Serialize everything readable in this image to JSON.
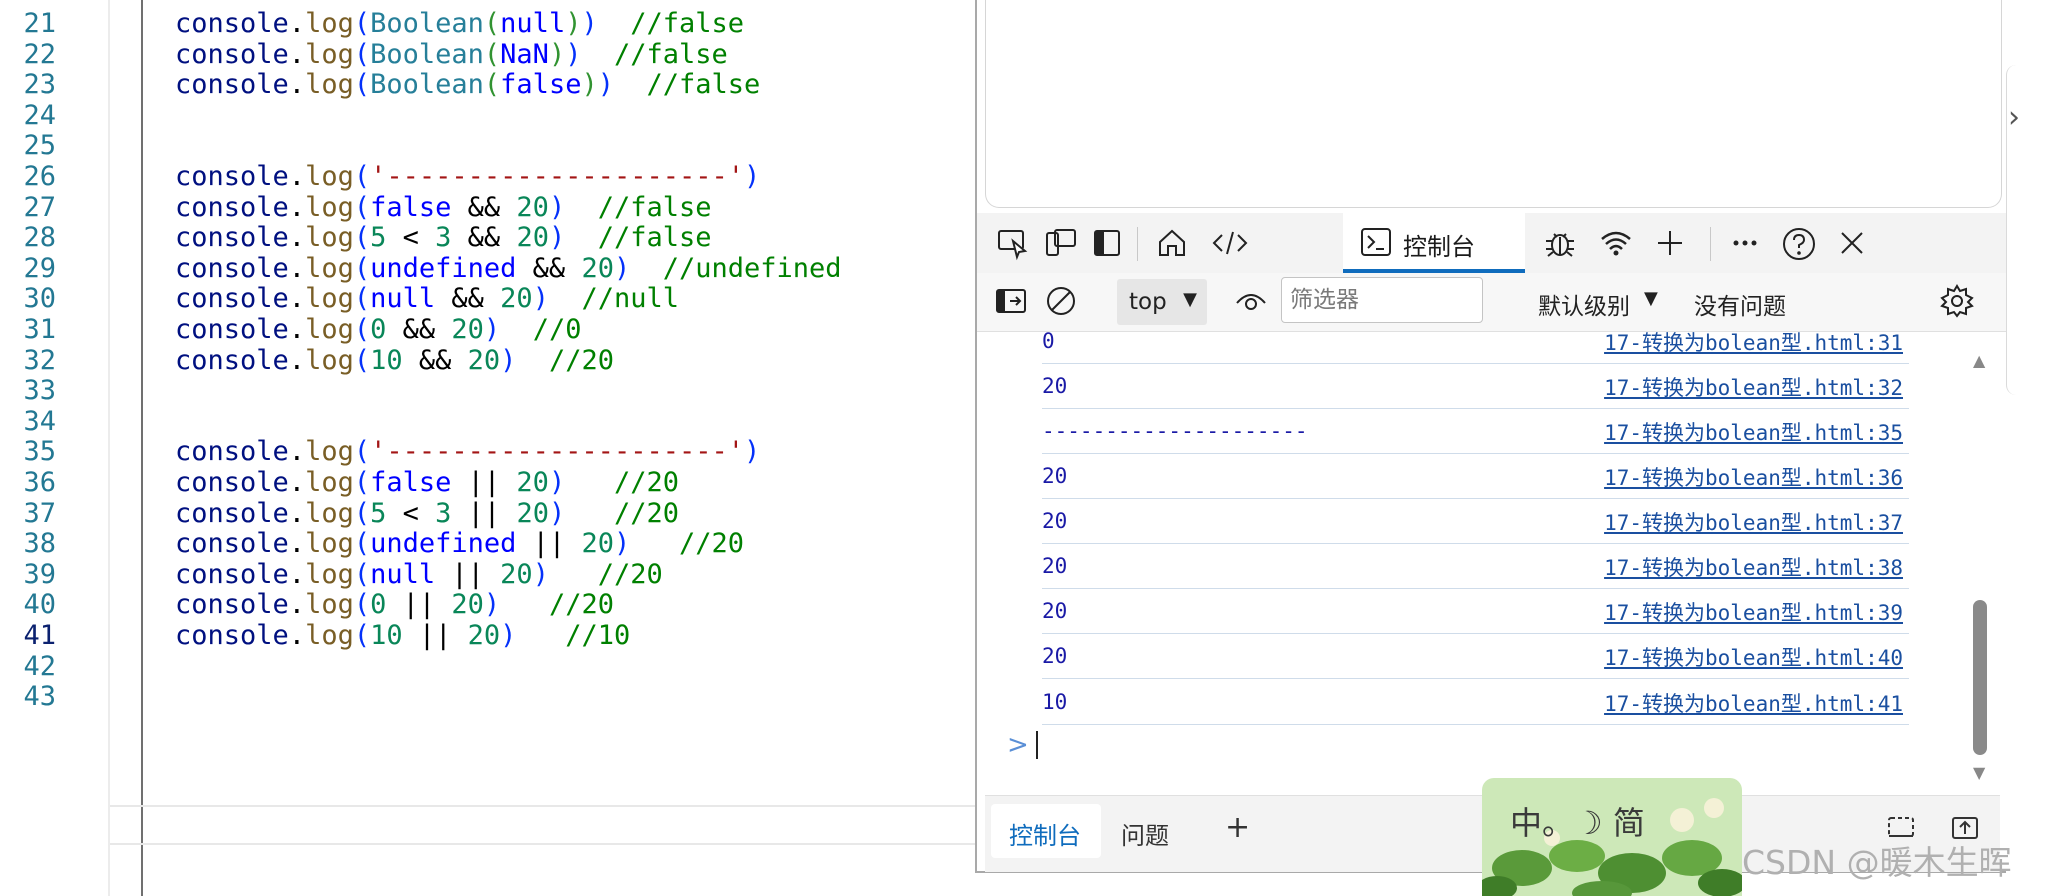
{
  "editor": {
    "lines": [
      {
        "num": "21",
        "tokens": [
          [
            "c-obj",
            "console"
          ],
          [
            "c-op",
            "."
          ],
          [
            "c-fn",
            "log"
          ],
          [
            "c-p1",
            "("
          ],
          [
            "c-type",
            "Boolean"
          ],
          [
            "c-p2",
            "("
          ],
          [
            "c-kw",
            "null"
          ],
          [
            "c-p2",
            ")"
          ],
          [
            "c-p1",
            ")"
          ],
          [
            "c-op",
            "  "
          ],
          [
            "c-cm",
            "//false"
          ]
        ]
      },
      {
        "num": "22",
        "tokens": [
          [
            "c-obj",
            "console"
          ],
          [
            "c-op",
            "."
          ],
          [
            "c-fn",
            "log"
          ],
          [
            "c-p1",
            "("
          ],
          [
            "c-type",
            "Boolean"
          ],
          [
            "c-p2",
            "("
          ],
          [
            "c-kw",
            "NaN"
          ],
          [
            "c-p2",
            ")"
          ],
          [
            "c-p1",
            ")"
          ],
          [
            "c-op",
            "  "
          ],
          [
            "c-cm",
            "//false"
          ]
        ]
      },
      {
        "num": "23",
        "tokens": [
          [
            "c-obj",
            "console"
          ],
          [
            "c-op",
            "."
          ],
          [
            "c-fn",
            "log"
          ],
          [
            "c-p1",
            "("
          ],
          [
            "c-type",
            "Boolean"
          ],
          [
            "c-p2",
            "("
          ],
          [
            "c-kw",
            "false"
          ],
          [
            "c-p2",
            ")"
          ],
          [
            "c-p1",
            ")"
          ],
          [
            "c-op",
            "  "
          ],
          [
            "c-cm",
            "//false"
          ]
        ]
      },
      {
        "num": "24",
        "tokens": []
      },
      {
        "num": "25",
        "tokens": []
      },
      {
        "num": "26",
        "tokens": [
          [
            "c-obj",
            "console"
          ],
          [
            "c-op",
            "."
          ],
          [
            "c-fn",
            "log"
          ],
          [
            "c-p1",
            "("
          ],
          [
            "c-str",
            "'---------------------'"
          ],
          [
            "c-p1",
            ")"
          ]
        ]
      },
      {
        "num": "27",
        "tokens": [
          [
            "c-obj",
            "console"
          ],
          [
            "c-op",
            "."
          ],
          [
            "c-fn",
            "log"
          ],
          [
            "c-p1",
            "("
          ],
          [
            "c-kw",
            "false"
          ],
          [
            "c-op",
            " && "
          ],
          [
            "c-num",
            "20"
          ],
          [
            "c-p1",
            ")"
          ],
          [
            "c-op",
            "  "
          ],
          [
            "c-cm",
            "//false"
          ]
        ]
      },
      {
        "num": "28",
        "tokens": [
          [
            "c-obj",
            "console"
          ],
          [
            "c-op",
            "."
          ],
          [
            "c-fn",
            "log"
          ],
          [
            "c-p1",
            "("
          ],
          [
            "c-num",
            "5"
          ],
          [
            "c-op",
            " < "
          ],
          [
            "c-num",
            "3"
          ],
          [
            "c-op",
            " && "
          ],
          [
            "c-num",
            "20"
          ],
          [
            "c-p1",
            ")"
          ],
          [
            "c-op",
            "  "
          ],
          [
            "c-cm",
            "//false"
          ]
        ]
      },
      {
        "num": "29",
        "tokens": [
          [
            "c-obj",
            "console"
          ],
          [
            "c-op",
            "."
          ],
          [
            "c-fn",
            "log"
          ],
          [
            "c-p1",
            "("
          ],
          [
            "c-kw",
            "undefined"
          ],
          [
            "c-op",
            " && "
          ],
          [
            "c-num",
            "20"
          ],
          [
            "c-p1",
            ")"
          ],
          [
            "c-op",
            "  "
          ],
          [
            "c-cm",
            "//undefined"
          ]
        ]
      },
      {
        "num": "30",
        "tokens": [
          [
            "c-obj",
            "console"
          ],
          [
            "c-op",
            "."
          ],
          [
            "c-fn",
            "log"
          ],
          [
            "c-p1",
            "("
          ],
          [
            "c-kw",
            "null"
          ],
          [
            "c-op",
            " && "
          ],
          [
            "c-num",
            "20"
          ],
          [
            "c-p1",
            ")"
          ],
          [
            "c-op",
            "  "
          ],
          [
            "c-cm",
            "//null"
          ]
        ]
      },
      {
        "num": "31",
        "tokens": [
          [
            "c-obj",
            "console"
          ],
          [
            "c-op",
            "."
          ],
          [
            "c-fn",
            "log"
          ],
          [
            "c-p1",
            "("
          ],
          [
            "c-num",
            "0"
          ],
          [
            "c-op",
            " && "
          ],
          [
            "c-num",
            "20"
          ],
          [
            "c-p1",
            ")"
          ],
          [
            "c-op",
            "  "
          ],
          [
            "c-cm",
            "//0"
          ]
        ]
      },
      {
        "num": "32",
        "tokens": [
          [
            "c-obj",
            "console"
          ],
          [
            "c-op",
            "."
          ],
          [
            "c-fn",
            "log"
          ],
          [
            "c-p1",
            "("
          ],
          [
            "c-num",
            "10"
          ],
          [
            "c-op",
            " && "
          ],
          [
            "c-num",
            "20"
          ],
          [
            "c-p1",
            ")"
          ],
          [
            "c-op",
            "  "
          ],
          [
            "c-cm",
            "//20"
          ]
        ]
      },
      {
        "num": "33",
        "tokens": []
      },
      {
        "num": "34",
        "tokens": []
      },
      {
        "num": "35",
        "tokens": [
          [
            "c-obj",
            "console"
          ],
          [
            "c-op",
            "."
          ],
          [
            "c-fn",
            "log"
          ],
          [
            "c-p1",
            "("
          ],
          [
            "c-str",
            "'---------------------'"
          ],
          [
            "c-p1",
            ")"
          ]
        ]
      },
      {
        "num": "36",
        "tokens": [
          [
            "c-obj",
            "console"
          ],
          [
            "c-op",
            "."
          ],
          [
            "c-fn",
            "log"
          ],
          [
            "c-p1",
            "("
          ],
          [
            "c-kw",
            "false"
          ],
          [
            "c-op",
            " || "
          ],
          [
            "c-num",
            "20"
          ],
          [
            "c-p1",
            ")"
          ],
          [
            "c-op",
            "   "
          ],
          [
            "c-cm",
            "//20"
          ]
        ]
      },
      {
        "num": "37",
        "tokens": [
          [
            "c-obj",
            "console"
          ],
          [
            "c-op",
            "."
          ],
          [
            "c-fn",
            "log"
          ],
          [
            "c-p1",
            "("
          ],
          [
            "c-num",
            "5"
          ],
          [
            "c-op",
            " < "
          ],
          [
            "c-num",
            "3"
          ],
          [
            "c-op",
            " || "
          ],
          [
            "c-num",
            "20"
          ],
          [
            "c-p1",
            ")"
          ],
          [
            "c-op",
            "   "
          ],
          [
            "c-cm",
            "//20"
          ]
        ]
      },
      {
        "num": "38",
        "tokens": [
          [
            "c-obj",
            "console"
          ],
          [
            "c-op",
            "."
          ],
          [
            "c-fn",
            "log"
          ],
          [
            "c-p1",
            "("
          ],
          [
            "c-kw",
            "undefined"
          ],
          [
            "c-op",
            " || "
          ],
          [
            "c-num",
            "20"
          ],
          [
            "c-p1",
            ")"
          ],
          [
            "c-op",
            "   "
          ],
          [
            "c-cm",
            "//20"
          ]
        ]
      },
      {
        "num": "39",
        "tokens": [
          [
            "c-obj",
            "console"
          ],
          [
            "c-op",
            "."
          ],
          [
            "c-fn",
            "log"
          ],
          [
            "c-p1",
            "("
          ],
          [
            "c-kw",
            "null"
          ],
          [
            "c-op",
            " || "
          ],
          [
            "c-num",
            "20"
          ],
          [
            "c-p1",
            ")"
          ],
          [
            "c-op",
            "   "
          ],
          [
            "c-cm",
            "//20"
          ]
        ]
      },
      {
        "num": "40",
        "tokens": [
          [
            "c-obj",
            "console"
          ],
          [
            "c-op",
            "."
          ],
          [
            "c-fn",
            "log"
          ],
          [
            "c-p1",
            "("
          ],
          [
            "c-num",
            "0"
          ],
          [
            "c-op",
            " || "
          ],
          [
            "c-num",
            "20"
          ],
          [
            "c-p1",
            ")"
          ],
          [
            "c-op",
            "   "
          ],
          [
            "c-cm",
            "//20"
          ]
        ]
      },
      {
        "num": "41",
        "tokens": [
          [
            "c-obj",
            "console"
          ],
          [
            "c-op",
            "."
          ],
          [
            "c-fn",
            "log"
          ],
          [
            "c-p1",
            "("
          ],
          [
            "c-num",
            "10"
          ],
          [
            "c-op",
            " || "
          ],
          [
            "c-num",
            "20"
          ],
          [
            "c-p1",
            ")"
          ],
          [
            "c-op",
            "   "
          ],
          [
            "c-cm",
            "//10"
          ]
        ]
      },
      {
        "num": "42",
        "tokens": []
      },
      {
        "num": "43",
        "tokens": []
      }
    ]
  },
  "devtools": {
    "tabs": {
      "console_label": "控制台"
    },
    "toolbar": {
      "context": "top",
      "filter_placeholder": "筛选器",
      "level_label": "默认级别",
      "issues_label": "没有问题"
    },
    "messages": [
      {
        "value": "0",
        "source": "17-转换为bolean型.html:31"
      },
      {
        "value": "20",
        "source": "17-转换为bolean型.html:32"
      },
      {
        "value": "---------------------",
        "source": "17-转换为bolean型.html:35"
      },
      {
        "value": "20",
        "source": "17-转换为bolean型.html:36"
      },
      {
        "value": "20",
        "source": "17-转换为bolean型.html:37"
      },
      {
        "value": "20",
        "source": "17-转换为bolean型.html:38"
      },
      {
        "value": "20",
        "source": "17-转换为bolean型.html:39"
      },
      {
        "value": "20",
        "source": "17-转换为bolean型.html:40"
      },
      {
        "value": "10",
        "source": "17-转换为bolean型.html:41"
      }
    ],
    "drawer": {
      "console_label": "控制台",
      "issues_label": "问题"
    }
  },
  "ime": {
    "text": "中。☽ 简"
  },
  "watermark": "CSDN @暖木生晖"
}
